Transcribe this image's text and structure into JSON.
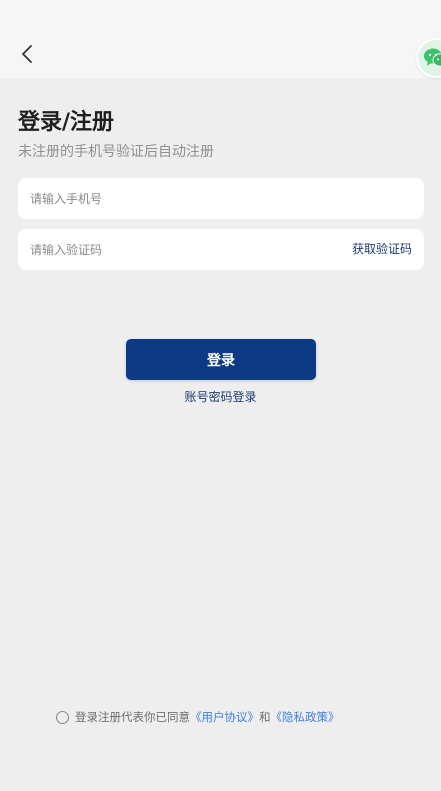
{
  "icons": {
    "back": "chevron-left-icon",
    "wechat": "wechat-icon"
  },
  "colors": {
    "primary": "#0d3a84",
    "link": "#3f7fe0",
    "wechat": "#3cc46b"
  },
  "header": {
    "title": "登录/注册",
    "subtitle": "未注册的手机号验证后自动注册"
  },
  "form": {
    "phone_placeholder": "请输入手机号",
    "phone_value": "",
    "code_placeholder": "请输入验证码",
    "code_value": "",
    "get_code_label": "获取验证码",
    "login_label": "登录",
    "password_login_label": "账号密码登录"
  },
  "agreement": {
    "text": "登录注册代表你已同意",
    "user_agreement": "《用户协议》",
    "conjunction": "和",
    "privacy_policy": "《隐私政策》",
    "checked": false
  }
}
